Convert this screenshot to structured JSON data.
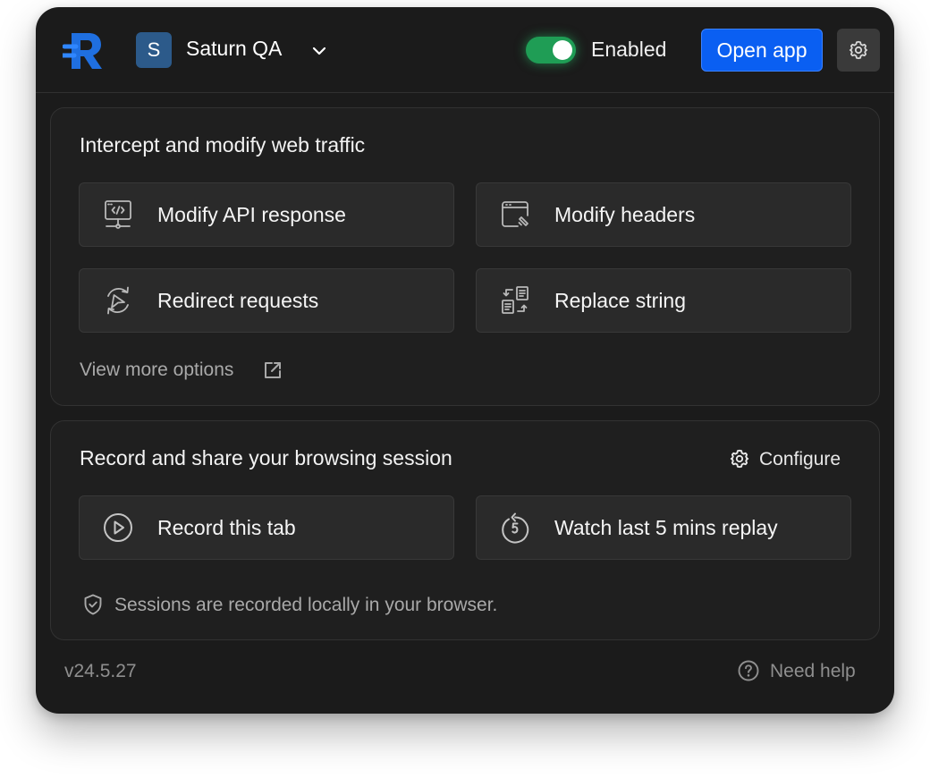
{
  "header": {
    "workspace_initial": "S",
    "workspace_name": "Saturn QA",
    "toggle_state": "on",
    "toggle_label": "Enabled",
    "open_app_label": "Open app"
  },
  "intercept": {
    "title": "Intercept and modify web traffic",
    "items": [
      {
        "label": "Modify API response",
        "icon": "api-response-icon"
      },
      {
        "label": "Modify headers",
        "icon": "headers-icon"
      },
      {
        "label": "Redirect requests",
        "icon": "redirect-icon"
      },
      {
        "label": "Replace string",
        "icon": "replace-string-icon"
      }
    ],
    "view_more_label": "View more options"
  },
  "record": {
    "title": "Record and share your browsing session",
    "configure_label": "Configure",
    "items": [
      {
        "label": "Record this tab",
        "icon": "play-circle-icon"
      },
      {
        "label": "Watch last 5 mins replay",
        "icon": "replay-5-icon"
      }
    ],
    "note": "Sessions are recorded locally in your browser."
  },
  "footer": {
    "version": "v24.5.27",
    "help_label": "Need help"
  },
  "colors": {
    "background": "#1b1b1b",
    "card": "#1f1f1f",
    "tile": "#2a2a2a",
    "accent_blue": "#0a5ff2",
    "toggle_green": "#1f9d55"
  }
}
